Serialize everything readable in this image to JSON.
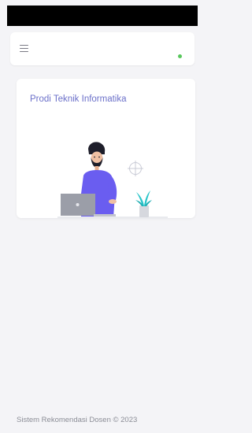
{
  "navbar": {
    "menu_icon": "hamburger-menu-icon",
    "status_color": "#58c75c"
  },
  "card": {
    "title": "Prodi Teknik Informatika",
    "illustration": "developer-at-laptop-illustration"
  },
  "footer": {
    "text": "Sistem Rekomendasi Dosen © 2023"
  },
  "colors": {
    "background": "#f4f4f7",
    "title": "#6b70c9",
    "accent_purple": "#6a5df0",
    "plant_teal": "#28c4c9"
  }
}
